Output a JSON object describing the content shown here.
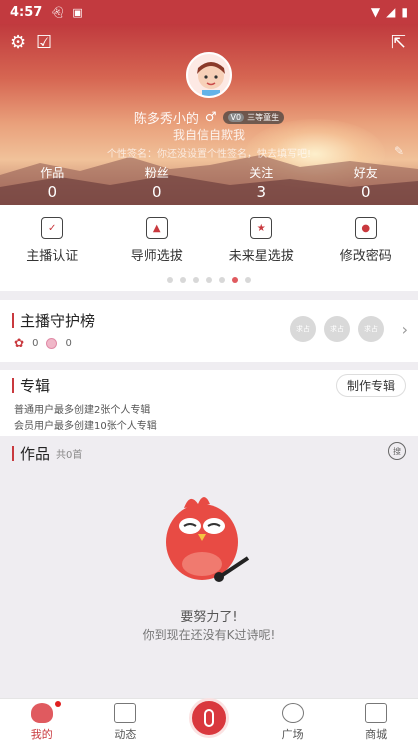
{
  "status_bar": {
    "time": "4:57"
  },
  "profile": {
    "nickname": "陈多秀小的",
    "gender_symbol": "♂",
    "level_badge": "V0",
    "level_title": "三等童生",
    "signature": "我自信自欺我",
    "intro": "个性签名：你还没设置个性签名，快去填写吧!",
    "stats": [
      {
        "label": "作品",
        "value": "0"
      },
      {
        "label": "粉丝",
        "value": "0"
      },
      {
        "label": "关注",
        "value": "3"
      },
      {
        "label": "好友",
        "value": "0"
      }
    ]
  },
  "functions": {
    "items": [
      {
        "label": "主播认证",
        "icon": "certificate-icon"
      },
      {
        "label": "导师选拔",
        "icon": "mortarboard-icon"
      },
      {
        "label": "未来星选拔",
        "icon": "star-doc-icon"
      },
      {
        "label": "修改密码",
        "icon": "lock-icon"
      }
    ],
    "page_count": 7,
    "active_page": 6
  },
  "guard": {
    "title": "主播守护榜",
    "flower_count": "0",
    "coin_count": "0",
    "seats": [
      "求占",
      "求占",
      "求占"
    ]
  },
  "album": {
    "title": "专辑",
    "button": "制作专辑",
    "notes": [
      "普通用户最多创建2张个人专辑",
      "会员用户最多创建10张个人专辑"
    ]
  },
  "works": {
    "title": "作品",
    "count": "共0首",
    "search_label": "搜",
    "empty_line1": "要努力了!",
    "empty_line2": "你到现在还没有K过诗呢!"
  },
  "nav": {
    "items": [
      {
        "label": "我的",
        "active": true
      },
      {
        "label": "动态"
      },
      {
        "label": ""
      },
      {
        "label": "广场"
      },
      {
        "label": "商城"
      }
    ]
  },
  "colors": {
    "brand": "#c9393e",
    "accent": "#e05a5f"
  }
}
